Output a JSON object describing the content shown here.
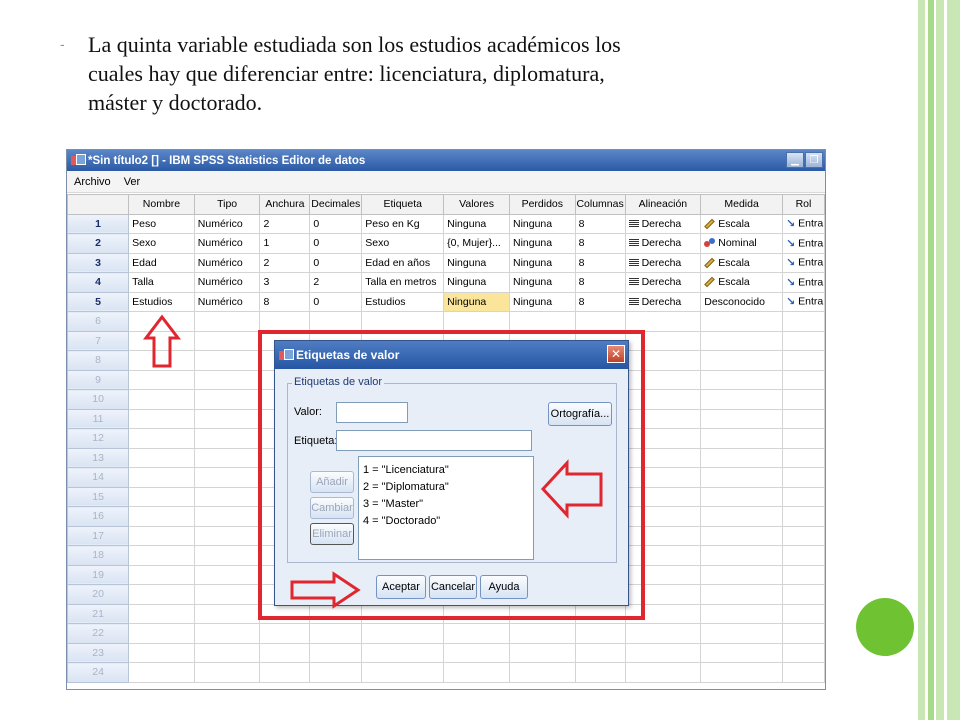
{
  "slide": {
    "bullet": "-",
    "text_lines": [
      "La quinta variable estudiada son los estudios académicos los",
      "cuales hay que diferenciar entre: licenciatura, diplomatura,",
      "máster y doctorado."
    ]
  },
  "spss": {
    "title": "*Sin título2 [] - IBM SPSS Statistics Editor de datos",
    "menu": [
      "Archivo",
      "Ver"
    ],
    "columns": [
      "Nombre",
      "Tipo",
      "Anchura",
      "Decimales",
      "Etiqueta",
      "Valores",
      "Perdidos",
      "Columnas",
      "Alineación",
      "Medida",
      "Rol"
    ],
    "rows": [
      {
        "n": "1",
        "nombre": "Peso",
        "tipo": "Numérico",
        "anchura": "2",
        "decimales": "0",
        "etiqueta": "Peso en Kg",
        "valores": "Ninguna",
        "perdidos": "Ninguna",
        "columnas": "8",
        "alineacion": "Derecha",
        "medida": "Escala",
        "medida_icon": "ruler-icon",
        "rol": "Entra"
      },
      {
        "n": "2",
        "nombre": "Sexo",
        "tipo": "Numérico",
        "anchura": "1",
        "decimales": "0",
        "etiqueta": "Sexo",
        "valores": "{0, Mujer}...",
        "perdidos": "Ninguna",
        "columnas": "8",
        "alineacion": "Derecha",
        "medida": "Nominal",
        "medida_icon": "nominal-icon",
        "rol": "Entra"
      },
      {
        "n": "3",
        "nombre": "Edad",
        "tipo": "Numérico",
        "anchura": "2",
        "decimales": "0",
        "etiqueta": "Edad en años",
        "valores": "Ninguna",
        "perdidos": "Ninguna",
        "columnas": "8",
        "alineacion": "Derecha",
        "medida": "Escala",
        "medida_icon": "ruler-icon",
        "rol": "Entra"
      },
      {
        "n": "4",
        "nombre": "Talla",
        "tipo": "Numérico",
        "anchura": "3",
        "decimales": "2",
        "etiqueta": "Talla en metros",
        "valores": "Ninguna",
        "perdidos": "Ninguna",
        "columnas": "8",
        "alineacion": "Derecha",
        "medida": "Escala",
        "medida_icon": "ruler-icon",
        "rol": "Entra"
      },
      {
        "n": "5",
        "nombre": "Estudios",
        "tipo": "Numérico",
        "anchura": "8",
        "decimales": "0",
        "etiqueta": "Estudios",
        "valores": "Ninguna",
        "perdidos": "Ninguna",
        "columnas": "8",
        "alineacion": "Derecha",
        "medida": "Desconocido",
        "medida_icon": "",
        "rol": "Entra"
      }
    ],
    "empty_row_numbers": [
      "6",
      "7",
      "8",
      "9",
      "10",
      "11",
      "12",
      "13",
      "14",
      "15",
      "16",
      "17",
      "18",
      "19",
      "20",
      "21",
      "22",
      "23",
      "24"
    ],
    "highlight_color": "#fbe59a"
  },
  "dialog": {
    "title": "Etiquetas de valor",
    "group_label": "Etiquetas de valor",
    "valor_label": "Valor:",
    "valor_value": "",
    "etiqueta_label": "Etiqueta:",
    "etiqueta_value": "",
    "ortografia_button": "Ortografía...",
    "add_button": "Añadir",
    "change_button": "Cambiar",
    "remove_button": "Eliminar",
    "labels": [
      "1 = \"Licenciatura\"",
      "2 = \"Diplomatura\"",
      "3 = \"Master\"",
      "4 = \"Doctorado\""
    ],
    "ok_button": "Aceptar",
    "cancel_button": "Cancelar",
    "help_button": "Ayuda"
  },
  "colors": {
    "annotation_red": "#e0262e",
    "accent_green": "#6fc332",
    "stripe_green": "#c9e7b4"
  }
}
